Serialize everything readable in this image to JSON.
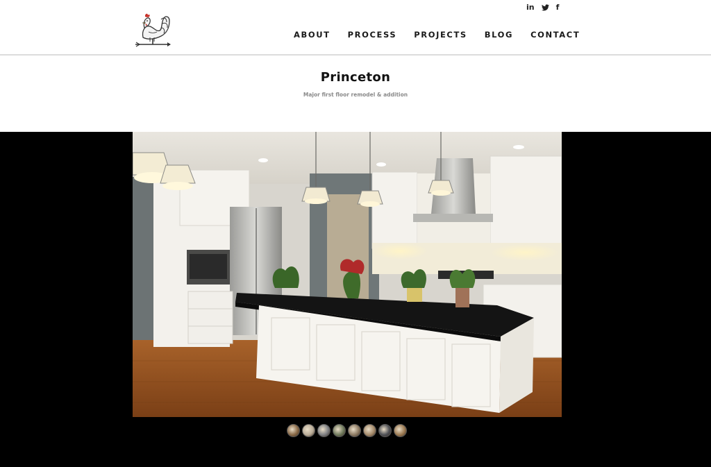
{
  "header": {
    "social": {
      "linkedin": "in",
      "twitter": "🐦",
      "facebook": "f"
    },
    "nav": [
      "ABOUT",
      "PROCESS",
      "PROJECTS",
      "BLOG",
      "CONTACT"
    ]
  },
  "page": {
    "title": "Princeton",
    "subtitle": "Major first floor remodel & addition"
  },
  "gallery": {
    "photo_icon": "kitchen-photo",
    "thumbnail_count": 8,
    "thumbnail_colors": [
      "#8a6a48",
      "#b9ac98",
      "#7e8084",
      "#6f7a5c",
      "#8d7b64",
      "#a58a6b",
      "#4d4f55",
      "#9c7a52"
    ]
  }
}
